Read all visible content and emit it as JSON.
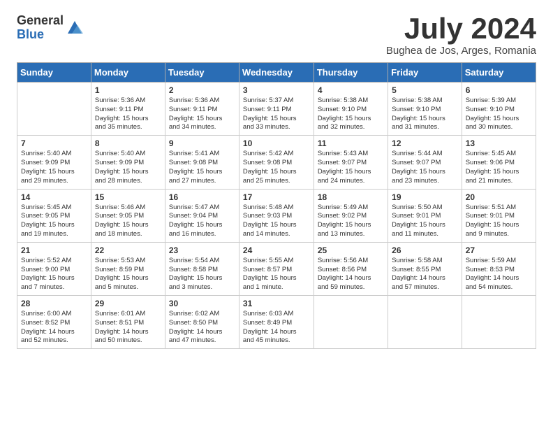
{
  "logo": {
    "general": "General",
    "blue": "Blue"
  },
  "title": "July 2024",
  "subtitle": "Bughea de Jos, Arges, Romania",
  "days_header": [
    "Sunday",
    "Monday",
    "Tuesday",
    "Wednesday",
    "Thursday",
    "Friday",
    "Saturday"
  ],
  "weeks": [
    [
      {
        "day": "",
        "info": ""
      },
      {
        "day": "1",
        "info": "Sunrise: 5:36 AM\nSunset: 9:11 PM\nDaylight: 15 hours\nand 35 minutes."
      },
      {
        "day": "2",
        "info": "Sunrise: 5:36 AM\nSunset: 9:11 PM\nDaylight: 15 hours\nand 34 minutes."
      },
      {
        "day": "3",
        "info": "Sunrise: 5:37 AM\nSunset: 9:11 PM\nDaylight: 15 hours\nand 33 minutes."
      },
      {
        "day": "4",
        "info": "Sunrise: 5:38 AM\nSunset: 9:10 PM\nDaylight: 15 hours\nand 32 minutes."
      },
      {
        "day": "5",
        "info": "Sunrise: 5:38 AM\nSunset: 9:10 PM\nDaylight: 15 hours\nand 31 minutes."
      },
      {
        "day": "6",
        "info": "Sunrise: 5:39 AM\nSunset: 9:10 PM\nDaylight: 15 hours\nand 30 minutes."
      }
    ],
    [
      {
        "day": "7",
        "info": "Sunrise: 5:40 AM\nSunset: 9:09 PM\nDaylight: 15 hours\nand 29 minutes."
      },
      {
        "day": "8",
        "info": "Sunrise: 5:40 AM\nSunset: 9:09 PM\nDaylight: 15 hours\nand 28 minutes."
      },
      {
        "day": "9",
        "info": "Sunrise: 5:41 AM\nSunset: 9:08 PM\nDaylight: 15 hours\nand 27 minutes."
      },
      {
        "day": "10",
        "info": "Sunrise: 5:42 AM\nSunset: 9:08 PM\nDaylight: 15 hours\nand 25 minutes."
      },
      {
        "day": "11",
        "info": "Sunrise: 5:43 AM\nSunset: 9:07 PM\nDaylight: 15 hours\nand 24 minutes."
      },
      {
        "day": "12",
        "info": "Sunrise: 5:44 AM\nSunset: 9:07 PM\nDaylight: 15 hours\nand 23 minutes."
      },
      {
        "day": "13",
        "info": "Sunrise: 5:45 AM\nSunset: 9:06 PM\nDaylight: 15 hours\nand 21 minutes."
      }
    ],
    [
      {
        "day": "14",
        "info": "Sunrise: 5:45 AM\nSunset: 9:05 PM\nDaylight: 15 hours\nand 19 minutes."
      },
      {
        "day": "15",
        "info": "Sunrise: 5:46 AM\nSunset: 9:05 PM\nDaylight: 15 hours\nand 18 minutes."
      },
      {
        "day": "16",
        "info": "Sunrise: 5:47 AM\nSunset: 9:04 PM\nDaylight: 15 hours\nand 16 minutes."
      },
      {
        "day": "17",
        "info": "Sunrise: 5:48 AM\nSunset: 9:03 PM\nDaylight: 15 hours\nand 14 minutes."
      },
      {
        "day": "18",
        "info": "Sunrise: 5:49 AM\nSunset: 9:02 PM\nDaylight: 15 hours\nand 13 minutes."
      },
      {
        "day": "19",
        "info": "Sunrise: 5:50 AM\nSunset: 9:01 PM\nDaylight: 15 hours\nand 11 minutes."
      },
      {
        "day": "20",
        "info": "Sunrise: 5:51 AM\nSunset: 9:01 PM\nDaylight: 15 hours\nand 9 minutes."
      }
    ],
    [
      {
        "day": "21",
        "info": "Sunrise: 5:52 AM\nSunset: 9:00 PM\nDaylight: 15 hours\nand 7 minutes."
      },
      {
        "day": "22",
        "info": "Sunrise: 5:53 AM\nSunset: 8:59 PM\nDaylight: 15 hours\nand 5 minutes."
      },
      {
        "day": "23",
        "info": "Sunrise: 5:54 AM\nSunset: 8:58 PM\nDaylight: 15 hours\nand 3 minutes."
      },
      {
        "day": "24",
        "info": "Sunrise: 5:55 AM\nSunset: 8:57 PM\nDaylight: 15 hours\nand 1 minute."
      },
      {
        "day": "25",
        "info": "Sunrise: 5:56 AM\nSunset: 8:56 PM\nDaylight: 14 hours\nand 59 minutes."
      },
      {
        "day": "26",
        "info": "Sunrise: 5:58 AM\nSunset: 8:55 PM\nDaylight: 14 hours\nand 57 minutes."
      },
      {
        "day": "27",
        "info": "Sunrise: 5:59 AM\nSunset: 8:53 PM\nDaylight: 14 hours\nand 54 minutes."
      }
    ],
    [
      {
        "day": "28",
        "info": "Sunrise: 6:00 AM\nSunset: 8:52 PM\nDaylight: 14 hours\nand 52 minutes."
      },
      {
        "day": "29",
        "info": "Sunrise: 6:01 AM\nSunset: 8:51 PM\nDaylight: 14 hours\nand 50 minutes."
      },
      {
        "day": "30",
        "info": "Sunrise: 6:02 AM\nSunset: 8:50 PM\nDaylight: 14 hours\nand 47 minutes."
      },
      {
        "day": "31",
        "info": "Sunrise: 6:03 AM\nSunset: 8:49 PM\nDaylight: 14 hours\nand 45 minutes."
      },
      {
        "day": "",
        "info": ""
      },
      {
        "day": "",
        "info": ""
      },
      {
        "day": "",
        "info": ""
      }
    ]
  ]
}
